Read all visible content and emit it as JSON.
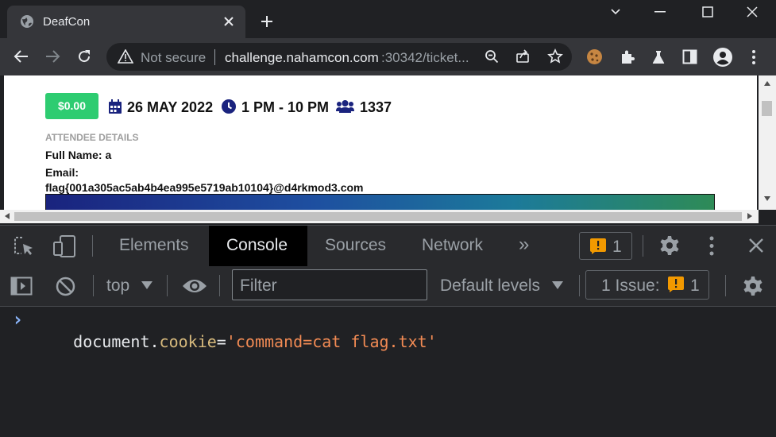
{
  "browser": {
    "tab_title": "DeafCon",
    "url_warning": "Not secure",
    "url_host": "challenge.nahamcon.com",
    "url_rest": ":30342/ticket...",
    "window_controls": [
      "minimize-icon",
      "maximize-icon",
      "close-icon"
    ]
  },
  "page": {
    "price_badge": "$0.00",
    "date": "26 MAY 2022",
    "time": "1 PM - 10 PM",
    "attendees": "1337",
    "section_label": "ATTENDEE DETAILS",
    "full_name_label": "Full Name: a",
    "email_label": "Email:",
    "email_value": "flag{001a305ac5ab4b4ea995e5719ab10104}@d4rkmod3.com",
    "colors": {
      "badge": "#2ecc71",
      "icon": "#1a237e"
    }
  },
  "devtools": {
    "tabs": {
      "elements": "Elements",
      "console": "Console",
      "sources": "Sources",
      "network": "Network",
      "more": "»"
    },
    "issues_badge_count": "1",
    "context": "top",
    "filter_placeholder": "Filter",
    "levels": "Default levels",
    "issues_label": "1 Issue:",
    "issues_count": "1",
    "console_input": {
      "prompt": "›",
      "object": "document",
      "dot": ".",
      "property": "cookie",
      "equals": "=",
      "string": "'command=cat flag.txt'"
    },
    "colors": {
      "accent": "#8ab4f8",
      "warning": "#f29900",
      "property": "#d7ba7d",
      "string": "#f28b54"
    }
  }
}
